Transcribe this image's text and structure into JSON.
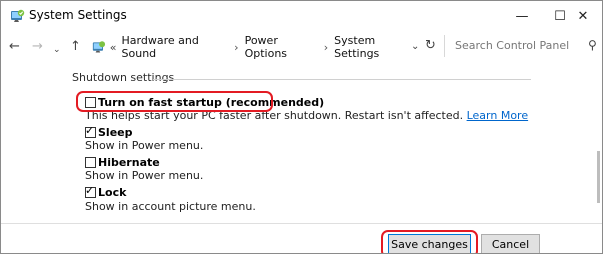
{
  "window": {
    "title": "System Settings",
    "controls": {
      "minimize": "—",
      "maximize": "☐",
      "close": "✕"
    }
  },
  "nav": {
    "back": "←",
    "forward": "→",
    "recent": "⌄",
    "up": "↑",
    "overflow": "«",
    "breadcrumbs": [
      "Hardware and Sound",
      "Power Options",
      "System Settings"
    ],
    "separator": "›",
    "dropdown": "⌄",
    "refresh": "↻",
    "search_placeholder": "Search Control Panel",
    "search_glyph": "⚲"
  },
  "shutdown": {
    "header": "Shutdown settings",
    "options": [
      {
        "label": "Turn on fast startup (recommended)",
        "checked": false,
        "desc": "This helps start your PC faster after shutdown. Restart isn't affected.",
        "link": "Learn More"
      },
      {
        "label": "Sleep",
        "checked": true,
        "desc": "Show in Power menu."
      },
      {
        "label": "Hibernate",
        "checked": false,
        "desc": "Show in Power menu."
      },
      {
        "label": "Lock",
        "checked": true,
        "desc": "Show in account picture menu."
      }
    ],
    "check_glyph": "✓"
  },
  "footer": {
    "save_label": "Save changes",
    "cancel_label": "Cancel"
  },
  "colors": {
    "highlight": "#e31b23",
    "link": "#0066cc",
    "accent": "#0078d7"
  }
}
